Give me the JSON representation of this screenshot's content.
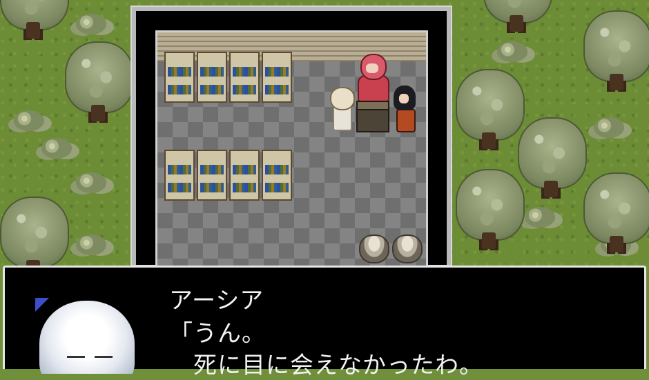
{
  "dialog": {
    "speaker": "アーシア",
    "lines": [
      "「うん。",
      "　死に目に会えなかったわ。"
    ]
  },
  "colors": {
    "grass": "#6d8c36",
    "dialog_bg": "#000000",
    "dialog_border": "#e6e6e6",
    "text": "#f2f2f2"
  },
  "icons": [
    "tree-icon",
    "bush-icon",
    "bookshelf-icon",
    "barrel-icon",
    "podium-icon"
  ]
}
